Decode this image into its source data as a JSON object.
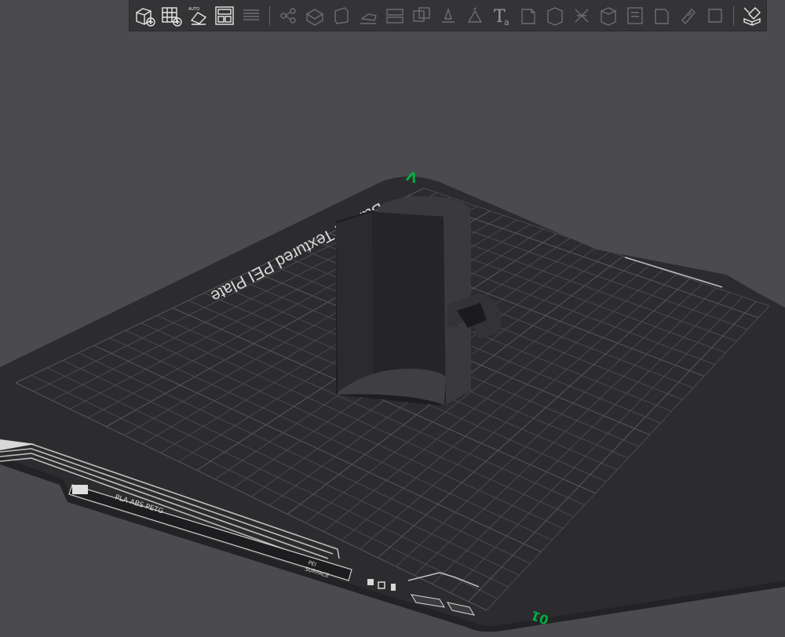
{
  "toolbar": {
    "groups": [
      {
        "items": [
          {
            "name": "add-part-icon",
            "enabled": true
          },
          {
            "name": "add-plate-icon",
            "enabled": true
          },
          {
            "name": "auto-orient-icon",
            "enabled": true,
            "label": "AUTO"
          },
          {
            "name": "arrange-icon",
            "enabled": true
          },
          {
            "name": "split-plate-icon",
            "enabled": false
          }
        ]
      },
      {
        "items": [
          {
            "name": "split-objects-icon",
            "enabled": false
          },
          {
            "name": "split-parts-icon",
            "enabled": false
          },
          {
            "name": "scale-icon",
            "enabled": false
          },
          {
            "name": "lay-on-face-icon",
            "enabled": false
          },
          {
            "name": "cut-icon",
            "enabled": false
          },
          {
            "name": "mesh-boolean-icon",
            "enabled": false
          },
          {
            "name": "support-paint-icon",
            "enabled": false
          },
          {
            "name": "color-paint-icon",
            "enabled": false
          },
          {
            "name": "text-emboss-icon",
            "enabled": false,
            "label": "T",
            "sub": "a"
          },
          {
            "name": "seam-paint-icon",
            "enabled": false
          },
          {
            "name": "variable-height-icon",
            "enabled": false
          },
          {
            "name": "fuzzy-skin-icon",
            "enabled": false
          },
          {
            "name": "measure-icon",
            "enabled": false
          },
          {
            "name": "assembly-icon",
            "enabled": false
          },
          {
            "name": "brim-ears-icon",
            "enabled": false
          },
          {
            "name": "svg-emboss-icon",
            "enabled": false
          },
          {
            "name": "hollow-icon",
            "enabled": false
          }
        ]
      },
      {
        "items": [
          {
            "name": "assembly-view-icon",
            "enabled": true
          }
        ]
      }
    ]
  },
  "bed": {
    "title": "Bambu Textured PEI Plate",
    "label_filaments": "PLA ABS PETG",
    "label_surface_top": "PEI",
    "label_surface_bottom": "SURFACE",
    "plate_number": "01",
    "front_axis_label": "V"
  },
  "colors": {
    "background": "#4b4b4e",
    "plate": "#2c2c2f",
    "grid": "#4a4a4e",
    "plate_text": "#d8d8d8",
    "accent": "#00ae42",
    "model": "#2e2e30",
    "toolbar": "#343436"
  }
}
